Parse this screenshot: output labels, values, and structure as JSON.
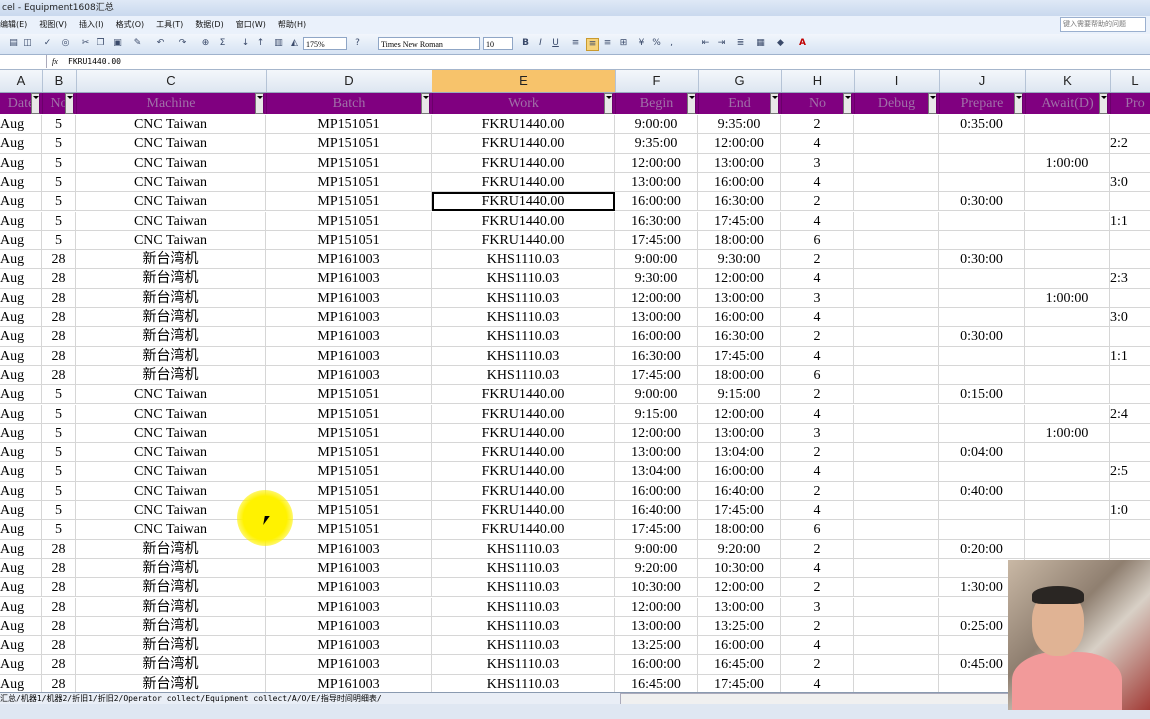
{
  "window": {
    "title": "cel - Equipment1608汇总"
  },
  "menu": [
    "编辑(E)",
    "视图(V)",
    "插入(I)",
    "格式(O)",
    "工具(T)",
    "数据(D)",
    "窗口(W)",
    "帮助(H)"
  ],
  "help_placeholder": "键入需要帮助的问题",
  "toolbar": {
    "zoom": "175%",
    "font_name": "Times New Roman",
    "font_size": "10",
    "bold": "B",
    "italic": "I",
    "underline": "U"
  },
  "formula": {
    "fx": "fx",
    "value": "FKRU1440.00"
  },
  "columns": [
    "A",
    "B",
    "C",
    "D",
    "E",
    "F",
    "G",
    "H",
    "I",
    "J",
    "K",
    "L"
  ],
  "headers": [
    "Date",
    "No",
    "Machine",
    "Batch",
    "Work",
    "Begin",
    "End",
    "No",
    "Debug",
    "Prepare",
    "Await(D)",
    "Pro"
  ],
  "rows": [
    [
      "Aug",
      "5",
      "CNC Taiwan",
      "MP151051",
      "FKRU1440.00",
      "9:00:00",
      "9:35:00",
      "2",
      "",
      "0:35:00",
      "",
      ""
    ],
    [
      "Aug",
      "5",
      "CNC Taiwan",
      "MP151051",
      "FKRU1440.00",
      "9:35:00",
      "12:00:00",
      "4",
      "",
      "",
      "",
      "2:2"
    ],
    [
      "Aug",
      "5",
      "CNC Taiwan",
      "MP151051",
      "FKRU1440.00",
      "12:00:00",
      "13:00:00",
      "3",
      "",
      "",
      "1:00:00",
      ""
    ],
    [
      "Aug",
      "5",
      "CNC Taiwan",
      "MP151051",
      "FKRU1440.00",
      "13:00:00",
      "16:00:00",
      "4",
      "",
      "",
      "",
      "3:0"
    ],
    [
      "Aug",
      "5",
      "CNC Taiwan",
      "MP151051",
      "FKRU1440.00",
      "16:00:00",
      "16:30:00",
      "2",
      "",
      "0:30:00",
      "",
      ""
    ],
    [
      "Aug",
      "5",
      "CNC Taiwan",
      "MP151051",
      "FKRU1440.00",
      "16:30:00",
      "17:45:00",
      "4",
      "",
      "",
      "",
      "1:1"
    ],
    [
      "Aug",
      "5",
      "CNC Taiwan",
      "MP151051",
      "FKRU1440.00",
      "17:45:00",
      "18:00:00",
      "6",
      "",
      "",
      "",
      ""
    ],
    [
      "Aug",
      "28",
      "新台湾机",
      "MP161003",
      "KHS1110.03",
      "9:00:00",
      "9:30:00",
      "2",
      "",
      "0:30:00",
      "",
      ""
    ],
    [
      "Aug",
      "28",
      "新台湾机",
      "MP161003",
      "KHS1110.03",
      "9:30:00",
      "12:00:00",
      "4",
      "",
      "",
      "",
      "2:3"
    ],
    [
      "Aug",
      "28",
      "新台湾机",
      "MP161003",
      "KHS1110.03",
      "12:00:00",
      "13:00:00",
      "3",
      "",
      "",
      "1:00:00",
      ""
    ],
    [
      "Aug",
      "28",
      "新台湾机",
      "MP161003",
      "KHS1110.03",
      "13:00:00",
      "16:00:00",
      "4",
      "",
      "",
      "",
      "3:0"
    ],
    [
      "Aug",
      "28",
      "新台湾机",
      "MP161003",
      "KHS1110.03",
      "16:00:00",
      "16:30:00",
      "2",
      "",
      "0:30:00",
      "",
      ""
    ],
    [
      "Aug",
      "28",
      "新台湾机",
      "MP161003",
      "KHS1110.03",
      "16:30:00",
      "17:45:00",
      "4",
      "",
      "",
      "",
      "1:1"
    ],
    [
      "Aug",
      "28",
      "新台湾机",
      "MP161003",
      "KHS1110.03",
      "17:45:00",
      "18:00:00",
      "6",
      "",
      "",
      "",
      ""
    ],
    [
      "Aug",
      "5",
      "CNC Taiwan",
      "MP151051",
      "FKRU1440.00",
      "9:00:00",
      "9:15:00",
      "2",
      "",
      "0:15:00",
      "",
      ""
    ],
    [
      "Aug",
      "5",
      "CNC Taiwan",
      "MP151051",
      "FKRU1440.00",
      "9:15:00",
      "12:00:00",
      "4",
      "",
      "",
      "",
      "2:4"
    ],
    [
      "Aug",
      "5",
      "CNC Taiwan",
      "MP151051",
      "FKRU1440.00",
      "12:00:00",
      "13:00:00",
      "3",
      "",
      "",
      "1:00:00",
      ""
    ],
    [
      "Aug",
      "5",
      "CNC Taiwan",
      "MP151051",
      "FKRU1440.00",
      "13:00:00",
      "13:04:00",
      "2",
      "",
      "0:04:00",
      "",
      ""
    ],
    [
      "Aug",
      "5",
      "CNC Taiwan",
      "MP151051",
      "FKRU1440.00",
      "13:04:00",
      "16:00:00",
      "4",
      "",
      "",
      "",
      "2:5"
    ],
    [
      "Aug",
      "5",
      "CNC Taiwan",
      "MP151051",
      "FKRU1440.00",
      "16:00:00",
      "16:40:00",
      "2",
      "",
      "0:40:00",
      "",
      ""
    ],
    [
      "Aug",
      "5",
      "CNC Taiwan",
      "MP151051",
      "FKRU1440.00",
      "16:40:00",
      "17:45:00",
      "4",
      "",
      "",
      "",
      "1:0"
    ],
    [
      "Aug",
      "5",
      "CNC Taiwan",
      "MP151051",
      "FKRU1440.00",
      "17:45:00",
      "18:00:00",
      "6",
      "",
      "",
      "",
      ""
    ],
    [
      "Aug",
      "28",
      "新台湾机",
      "MP161003",
      "KHS1110.03",
      "9:00:00",
      "9:20:00",
      "2",
      "",
      "0:20:00",
      "",
      ""
    ],
    [
      "Aug",
      "28",
      "新台湾机",
      "MP161003",
      "KHS1110.03",
      "9:20:00",
      "10:30:00",
      "4",
      "",
      "",
      "",
      ""
    ],
    [
      "Aug",
      "28",
      "新台湾机",
      "MP161003",
      "KHS1110.03",
      "10:30:00",
      "12:00:00",
      "2",
      "",
      "1:30:00",
      "",
      ""
    ],
    [
      "Aug",
      "28",
      "新台湾机",
      "MP161003",
      "KHS1110.03",
      "12:00:00",
      "13:00:00",
      "3",
      "",
      "",
      "",
      ""
    ],
    [
      "Aug",
      "28",
      "新台湾机",
      "MP161003",
      "KHS1110.03",
      "13:00:00",
      "13:25:00",
      "2",
      "",
      "0:25:00",
      "",
      ""
    ],
    [
      "Aug",
      "28",
      "新台湾机",
      "MP161003",
      "KHS1110.03",
      "13:25:00",
      "16:00:00",
      "4",
      "",
      "",
      "",
      ""
    ],
    [
      "Aug",
      "28",
      "新台湾机",
      "MP161003",
      "KHS1110.03",
      "16:00:00",
      "16:45:00",
      "2",
      "",
      "0:45:00",
      "",
      ""
    ],
    [
      "Aug",
      "28",
      "新台湾机",
      "MP161003",
      "KHS1110.03",
      "16:45:00",
      "17:45:00",
      "4",
      "",
      "",
      "",
      ""
    ]
  ],
  "sheet_tabs": "汇总/机器1/机器2/折旧1/折旧2/Operator collect/Equipment collect/A/O/E/指导时间明细表/"
}
